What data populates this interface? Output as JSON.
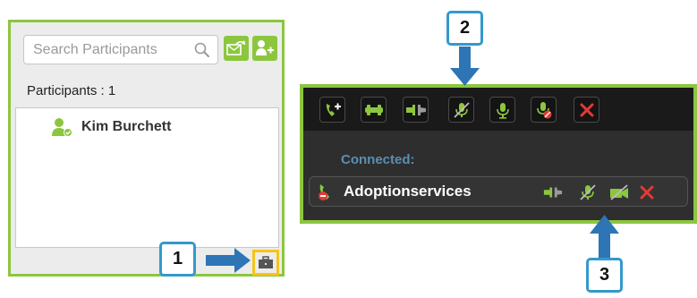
{
  "left_panel": {
    "search": {
      "placeholder": "Search Participants"
    },
    "participants_count": "Participants : 1",
    "participants": [
      {
        "name": "Kim Burchett"
      }
    ]
  },
  "right_panel": {
    "connected_label": "Connected:",
    "connection_name": "Adoptionservices",
    "control_icons": [
      "add-call-icon",
      "hold-icon",
      "transfer-icon",
      "mute-icon",
      "microphone-icon",
      "record-icon",
      "end-call-icon"
    ],
    "row_icons": [
      "transfer-icon",
      "mute-icon",
      "video-off-icon",
      "remove-icon"
    ]
  },
  "callouts": [
    "1",
    "2",
    "3"
  ],
  "colors": {
    "accent_green": "#8cc63f",
    "callout_blue": "#3399cc",
    "highlight_yellow": "#f5c518",
    "end_red": "#e53935"
  }
}
